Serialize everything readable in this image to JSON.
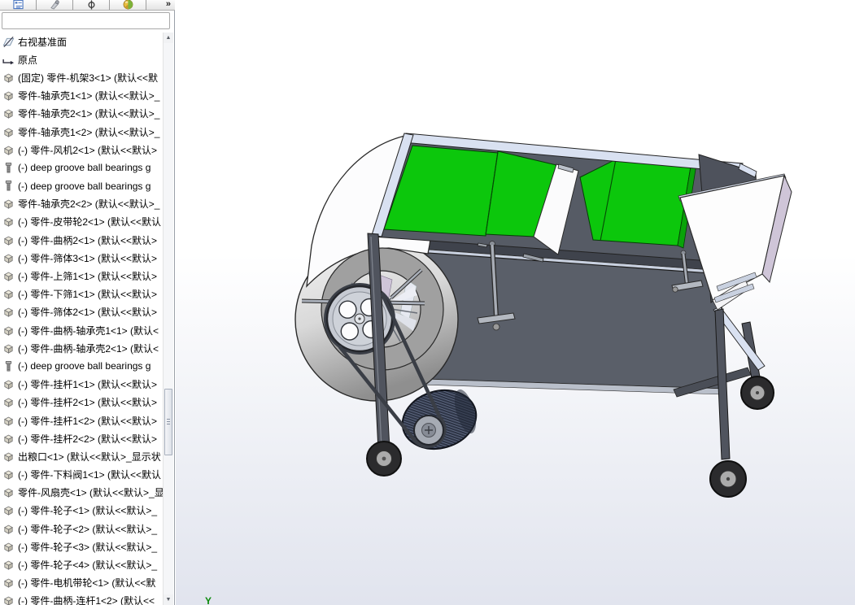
{
  "colors": {
    "green": "#0cc70c",
    "green-side": "#09a309",
    "body-gray": "#5a5f69",
    "body-top": "#565b65",
    "rail-dark": "#3f434c",
    "rail-light": "#d9e1f1",
    "ring-gray": "#a0a0a0",
    "lavender": "#cfc5d8",
    "belt-dark": "#3a3e46",
    "leg-gray": "#50545e",
    "tire-dark": "#2b2b2d",
    "hub-gray": "#ababab"
  },
  "panel": {
    "tabs": [
      {
        "id": "featuremanager-tab",
        "icon": "tree"
      },
      {
        "id": "propertymanager-tab",
        "icon": "property"
      },
      {
        "id": "dimxpertmanager-tab",
        "icon": "dimxpert"
      },
      {
        "id": "displaymanager-tab",
        "icon": "display"
      }
    ],
    "chevron": "»",
    "tree": [
      {
        "icon": "plane",
        "label": "右视基准面"
      },
      {
        "icon": "origin",
        "label": "原点"
      },
      {
        "icon": "part",
        "label": "(固定) 零件-机架3<1> (默认<<默"
      },
      {
        "icon": "part",
        "label": "零件-轴承壳1<1> (默认<<默认>_"
      },
      {
        "icon": "part",
        "label": "零件-轴承壳2<1> (默认<<默认>_"
      },
      {
        "icon": "part",
        "label": "零件-轴承壳1<2> (默认<<默认>_"
      },
      {
        "icon": "part",
        "label": "(-) 零件-风机2<1> (默认<<默认>"
      },
      {
        "icon": "bearing",
        "label": "(-) deep groove ball bearings g"
      },
      {
        "icon": "bearing",
        "label": "(-) deep groove ball bearings g"
      },
      {
        "icon": "part",
        "label": "零件-轴承壳2<2> (默认<<默认>_"
      },
      {
        "icon": "part",
        "label": "(-) 零件-皮带轮2<1> (默认<<默认"
      },
      {
        "icon": "part",
        "label": "(-) 零件-曲柄2<1> (默认<<默认>"
      },
      {
        "icon": "part",
        "label": "(-) 零件-筛体3<1> (默认<<默认>"
      },
      {
        "icon": "part",
        "label": "(-) 零件-上筛1<1> (默认<<默认>"
      },
      {
        "icon": "part",
        "label": "(-) 零件-下筛1<1> (默认<<默认>"
      },
      {
        "icon": "part",
        "label": "(-) 零件-筛体2<1> (默认<<默认>"
      },
      {
        "icon": "part",
        "label": "(-) 零件-曲柄-轴承壳1<1> (默认<"
      },
      {
        "icon": "part",
        "label": "(-) 零件-曲柄-轴承壳2<1> (默认<"
      },
      {
        "icon": "bearing",
        "label": "(-) deep groove ball bearings g"
      },
      {
        "icon": "part",
        "label": "(-) 零件-挂杆1<1> (默认<<默认>"
      },
      {
        "icon": "part",
        "label": "(-) 零件-挂杆2<1> (默认<<默认>"
      },
      {
        "icon": "part",
        "label": "(-) 零件-挂杆1<2> (默认<<默认>"
      },
      {
        "icon": "part",
        "label": "(-) 零件-挂杆2<2> (默认<<默认>"
      },
      {
        "icon": "part",
        "label": "出粮口<1> (默认<<默认>_显示状"
      },
      {
        "icon": "part",
        "label": "(-) 零件-下料阀1<1> (默认<<默认"
      },
      {
        "icon": "part",
        "label": "零件-风扇壳<1> (默认<<默认>_显"
      },
      {
        "icon": "part",
        "label": "(-) 零件-轮子<1> (默认<<默认>_"
      },
      {
        "icon": "part",
        "label": "(-) 零件-轮子<2> (默认<<默认>_"
      },
      {
        "icon": "part",
        "label": "(-) 零件-轮子<3> (默认<<默认>_"
      },
      {
        "icon": "part",
        "label": "(-) 零件-轮子<4> (默认<<默认>_"
      },
      {
        "icon": "part",
        "label": "(-) 零件-电机带轮<1> (默认<<默"
      },
      {
        "icon": "part",
        "label": "(-) 零件-曲柄-连杆1<2> (默认<<"
      }
    ]
  },
  "viewport": {
    "triad_y": "Y"
  }
}
